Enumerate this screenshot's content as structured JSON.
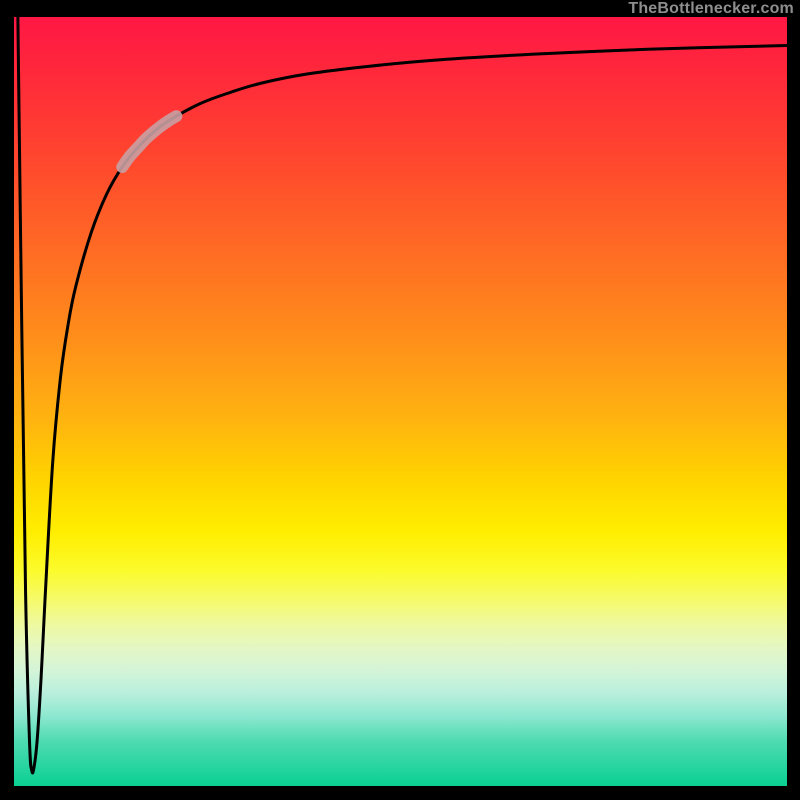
{
  "watermark": "TheBottlenecker.com",
  "chart_data": {
    "type": "line",
    "title": "",
    "xlabel": "",
    "ylabel": "",
    "xlim": [
      0,
      100
    ],
    "ylim": [
      0,
      100
    ],
    "background_gradient": {
      "direction": "vertical",
      "top_color": "#ff1744",
      "mid_color": "#ffee00",
      "bottom_color": "#0bcf90"
    },
    "axes_color": "#000000",
    "series": [
      {
        "name": "bottleneck-curve",
        "stroke": "#000000",
        "stroke_width": 3,
        "x": [
          0.5,
          1.0,
          1.5,
          2.0,
          2.3,
          2.6,
          3.0,
          3.5,
          4.0,
          5.0,
          6.0,
          7.0,
          8.0,
          10.0,
          12.0,
          14.0,
          16.0,
          18.0,
          20.0,
          24.0,
          28.0,
          32.0,
          38.0,
          46.0,
          56.0,
          68.0,
          82.0,
          100.0
        ],
        "y": [
          100,
          60,
          25,
          6,
          2,
          2.5,
          6,
          14,
          24,
          42,
          53,
          60,
          65,
          72,
          77,
          80.5,
          83,
          85,
          86.5,
          88.7,
          90.2,
          91.4,
          92.6,
          93.6,
          94.5,
          95.2,
          95.8,
          96.3
        ]
      },
      {
        "name": "highlight-band",
        "stroke": "#c9a0a3",
        "stroke_width": 12,
        "opacity": 0.9,
        "x": [
          14.0,
          15.0,
          16.0,
          17.0,
          18.0,
          19.0,
          20.0,
          21.0
        ],
        "y": [
          80.5,
          81.9,
          83.0,
          84.1,
          85.0,
          85.8,
          86.5,
          87.1
        ]
      }
    ]
  }
}
